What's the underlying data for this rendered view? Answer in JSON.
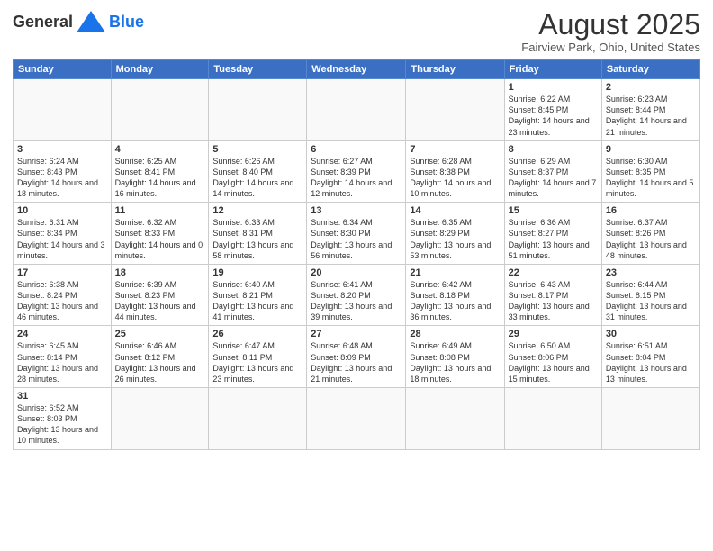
{
  "header": {
    "logo_general": "General",
    "logo_blue": "Blue",
    "title": "August 2025",
    "location": "Fairview Park, Ohio, United States"
  },
  "days_of_week": [
    "Sunday",
    "Monday",
    "Tuesday",
    "Wednesday",
    "Thursday",
    "Friday",
    "Saturday"
  ],
  "weeks": [
    [
      {
        "day": "",
        "info": ""
      },
      {
        "day": "",
        "info": ""
      },
      {
        "day": "",
        "info": ""
      },
      {
        "day": "",
        "info": ""
      },
      {
        "day": "",
        "info": ""
      },
      {
        "day": "1",
        "info": "Sunrise: 6:22 AM\nSunset: 8:45 PM\nDaylight: 14 hours and 23 minutes."
      },
      {
        "day": "2",
        "info": "Sunrise: 6:23 AM\nSunset: 8:44 PM\nDaylight: 14 hours and 21 minutes."
      }
    ],
    [
      {
        "day": "3",
        "info": "Sunrise: 6:24 AM\nSunset: 8:43 PM\nDaylight: 14 hours and 18 minutes."
      },
      {
        "day": "4",
        "info": "Sunrise: 6:25 AM\nSunset: 8:41 PM\nDaylight: 14 hours and 16 minutes."
      },
      {
        "day": "5",
        "info": "Sunrise: 6:26 AM\nSunset: 8:40 PM\nDaylight: 14 hours and 14 minutes."
      },
      {
        "day": "6",
        "info": "Sunrise: 6:27 AM\nSunset: 8:39 PM\nDaylight: 14 hours and 12 minutes."
      },
      {
        "day": "7",
        "info": "Sunrise: 6:28 AM\nSunset: 8:38 PM\nDaylight: 14 hours and 10 minutes."
      },
      {
        "day": "8",
        "info": "Sunrise: 6:29 AM\nSunset: 8:37 PM\nDaylight: 14 hours and 7 minutes."
      },
      {
        "day": "9",
        "info": "Sunrise: 6:30 AM\nSunset: 8:35 PM\nDaylight: 14 hours and 5 minutes."
      }
    ],
    [
      {
        "day": "10",
        "info": "Sunrise: 6:31 AM\nSunset: 8:34 PM\nDaylight: 14 hours and 3 minutes."
      },
      {
        "day": "11",
        "info": "Sunrise: 6:32 AM\nSunset: 8:33 PM\nDaylight: 14 hours and 0 minutes."
      },
      {
        "day": "12",
        "info": "Sunrise: 6:33 AM\nSunset: 8:31 PM\nDaylight: 13 hours and 58 minutes."
      },
      {
        "day": "13",
        "info": "Sunrise: 6:34 AM\nSunset: 8:30 PM\nDaylight: 13 hours and 56 minutes."
      },
      {
        "day": "14",
        "info": "Sunrise: 6:35 AM\nSunset: 8:29 PM\nDaylight: 13 hours and 53 minutes."
      },
      {
        "day": "15",
        "info": "Sunrise: 6:36 AM\nSunset: 8:27 PM\nDaylight: 13 hours and 51 minutes."
      },
      {
        "day": "16",
        "info": "Sunrise: 6:37 AM\nSunset: 8:26 PM\nDaylight: 13 hours and 48 minutes."
      }
    ],
    [
      {
        "day": "17",
        "info": "Sunrise: 6:38 AM\nSunset: 8:24 PM\nDaylight: 13 hours and 46 minutes."
      },
      {
        "day": "18",
        "info": "Sunrise: 6:39 AM\nSunset: 8:23 PM\nDaylight: 13 hours and 44 minutes."
      },
      {
        "day": "19",
        "info": "Sunrise: 6:40 AM\nSunset: 8:21 PM\nDaylight: 13 hours and 41 minutes."
      },
      {
        "day": "20",
        "info": "Sunrise: 6:41 AM\nSunset: 8:20 PM\nDaylight: 13 hours and 39 minutes."
      },
      {
        "day": "21",
        "info": "Sunrise: 6:42 AM\nSunset: 8:18 PM\nDaylight: 13 hours and 36 minutes."
      },
      {
        "day": "22",
        "info": "Sunrise: 6:43 AM\nSunset: 8:17 PM\nDaylight: 13 hours and 33 minutes."
      },
      {
        "day": "23",
        "info": "Sunrise: 6:44 AM\nSunset: 8:15 PM\nDaylight: 13 hours and 31 minutes."
      }
    ],
    [
      {
        "day": "24",
        "info": "Sunrise: 6:45 AM\nSunset: 8:14 PM\nDaylight: 13 hours and 28 minutes."
      },
      {
        "day": "25",
        "info": "Sunrise: 6:46 AM\nSunset: 8:12 PM\nDaylight: 13 hours and 26 minutes."
      },
      {
        "day": "26",
        "info": "Sunrise: 6:47 AM\nSunset: 8:11 PM\nDaylight: 13 hours and 23 minutes."
      },
      {
        "day": "27",
        "info": "Sunrise: 6:48 AM\nSunset: 8:09 PM\nDaylight: 13 hours and 21 minutes."
      },
      {
        "day": "28",
        "info": "Sunrise: 6:49 AM\nSunset: 8:08 PM\nDaylight: 13 hours and 18 minutes."
      },
      {
        "day": "29",
        "info": "Sunrise: 6:50 AM\nSunset: 8:06 PM\nDaylight: 13 hours and 15 minutes."
      },
      {
        "day": "30",
        "info": "Sunrise: 6:51 AM\nSunset: 8:04 PM\nDaylight: 13 hours and 13 minutes."
      }
    ],
    [
      {
        "day": "31",
        "info": "Sunrise: 6:52 AM\nSunset: 8:03 PM\nDaylight: 13 hours and 10 minutes."
      },
      {
        "day": "",
        "info": ""
      },
      {
        "day": "",
        "info": ""
      },
      {
        "day": "",
        "info": ""
      },
      {
        "day": "",
        "info": ""
      },
      {
        "day": "",
        "info": ""
      },
      {
        "day": "",
        "info": ""
      }
    ]
  ]
}
